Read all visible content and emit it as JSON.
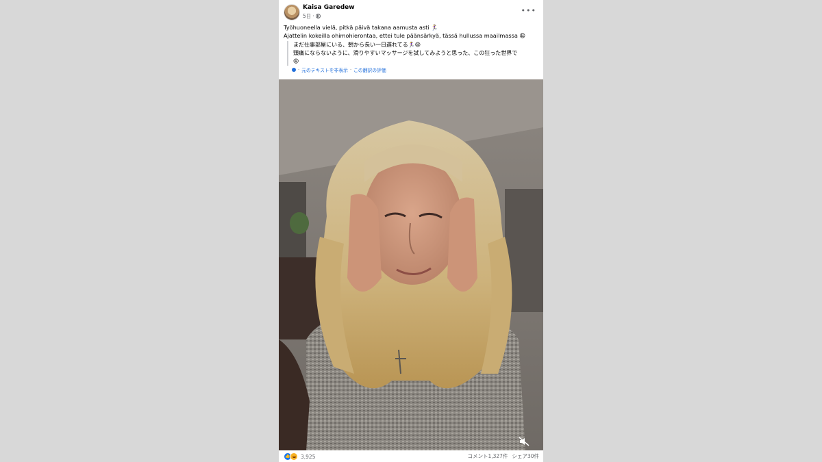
{
  "post": {
    "author": "Kaisa Garedew",
    "time": "5日",
    "meta_separator": "·",
    "more_label": "•••",
    "text_lines": [
      "Työhuoneella vielä, pitkä päivä takana aamusta asti 🏃‍♀️",
      "Ajattelin kokeilla ohimohierontaa, ettei tule päänsärkyä, tässä hullussa maailmassa 😩"
    ],
    "translation_lines": [
      "まだ仕事部屋にいる、朝から長い一日遅れてる🏃‍♀️😩",
      "頭痛にならないように、滑りやすいマッサージを試してみようと思った、この狂った世界で",
      "😩"
    ],
    "translation_links": {
      "hide_original": "元のテキストを非表示",
      "separator": "·",
      "rate_translation": "この翻訳の評価"
    }
  },
  "footer": {
    "reaction_count": "3,925",
    "comments": "コメント1,327件",
    "shares": "シェア30件"
  },
  "colors": {
    "link": "#216fdb",
    "like": "#1877f2",
    "haha": "#f7b125",
    "muted_text": "#65676b"
  },
  "icons": {
    "avatar": "profile-photo",
    "globe": "globe-icon",
    "more": "more-dots-icon",
    "mute": "speaker-muted-icon",
    "like": "like-icon",
    "haha": "haha-icon"
  }
}
